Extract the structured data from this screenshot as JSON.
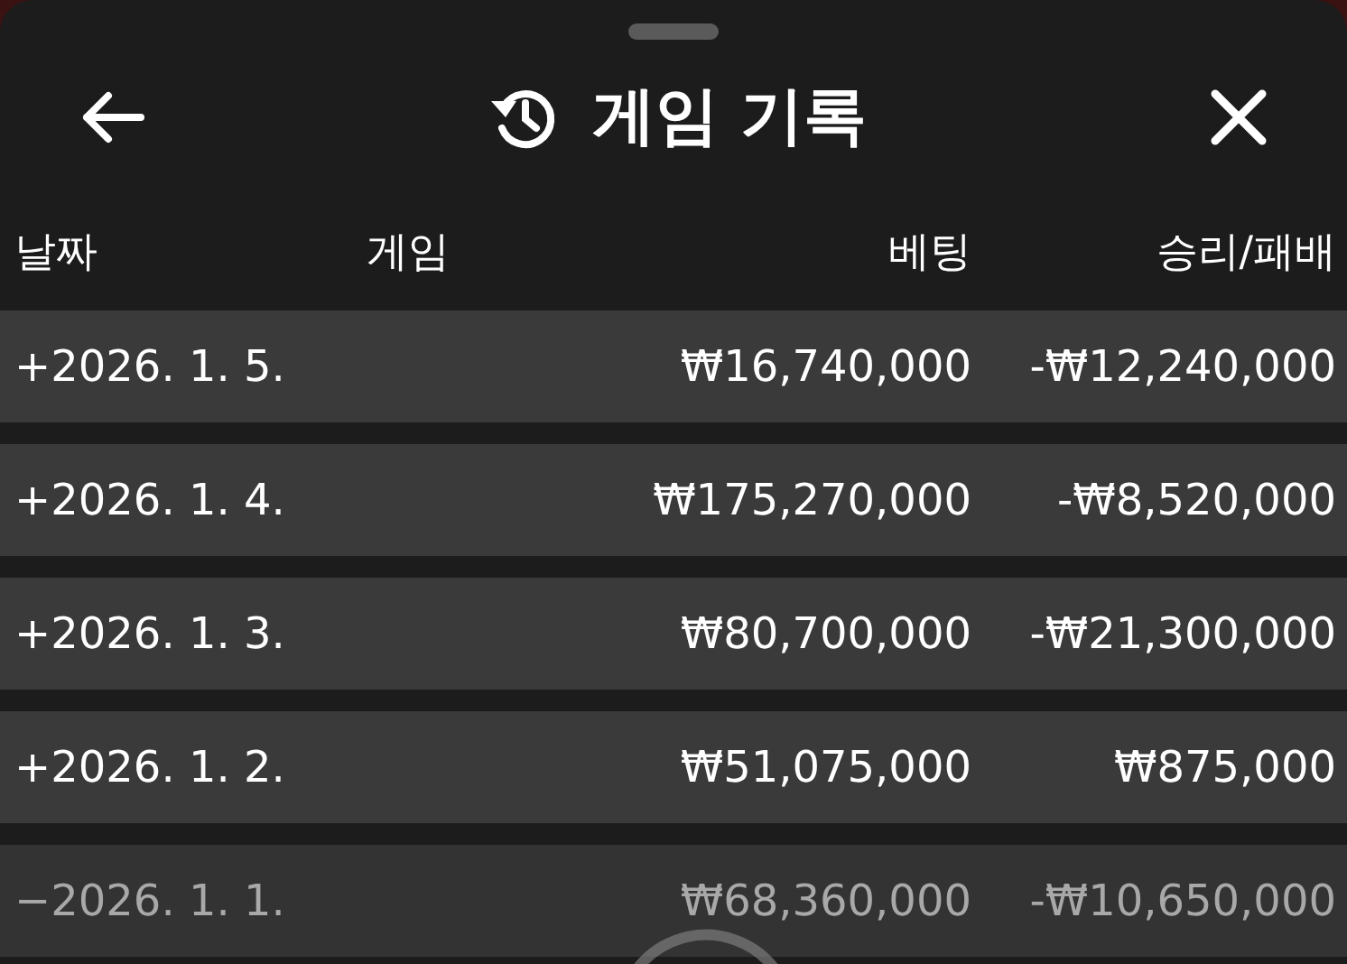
{
  "header": {
    "title": "게임 기록"
  },
  "table": {
    "columns": [
      "날짜",
      "게임",
      "베팅",
      "승리/패배"
    ],
    "rows": [
      {
        "date": "+2026. 1. 5.",
        "bet": "₩16,740,000",
        "result": "-₩12,240,000",
        "dimmed": false
      },
      {
        "date": "+2026. 1. 4.",
        "bet": "₩175,270,000",
        "result": "-₩8,520,000",
        "dimmed": false
      },
      {
        "date": "+2026. 1. 3.",
        "bet": "₩80,700,000",
        "result": "-₩21,300,000",
        "dimmed": false
      },
      {
        "date": "+2026. 1. 2.",
        "bet": "₩51,075,000",
        "result": "₩875,000",
        "dimmed": false
      },
      {
        "date": "−2026. 1. 1.",
        "bet": "₩68,360,000",
        "result": "-₩10,650,000",
        "dimmed": true
      }
    ]
  }
}
